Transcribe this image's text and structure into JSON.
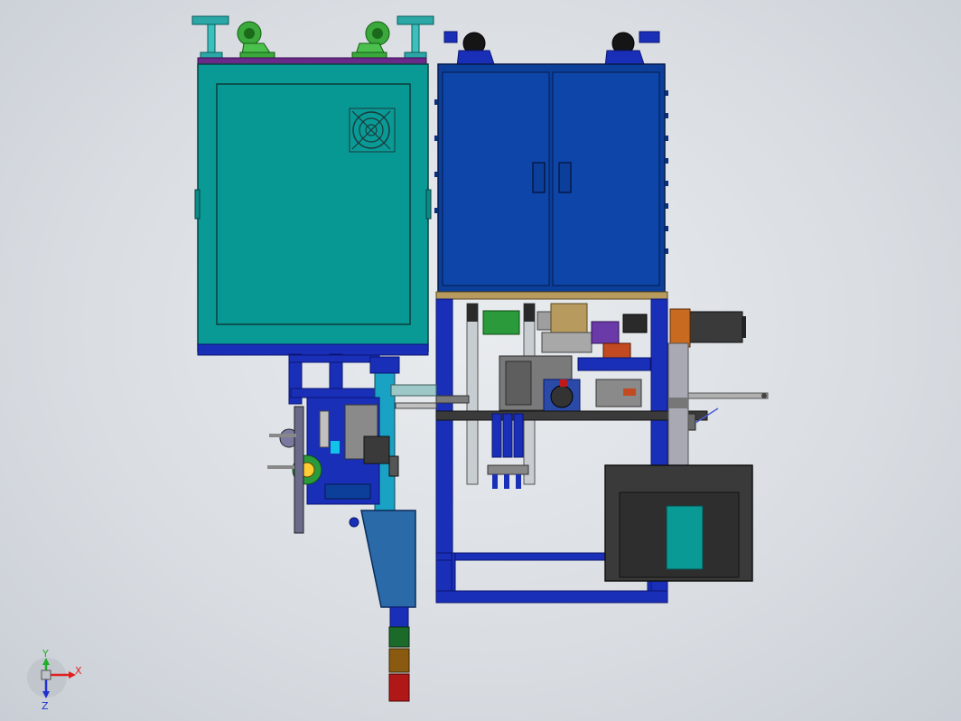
{
  "viewport": {
    "background_color": "#dde1e6"
  },
  "triad": {
    "x_label": "X",
    "y_label": "Y",
    "z_label": "Z",
    "x_color": "#e02020",
    "y_color": "#1fae2a",
    "z_color": "#2030d0"
  },
  "colors": {
    "teal_cabinet": "#0a9a96",
    "blue_cabinet": "#0c3f9a",
    "frame_blue": "#1a2fb8",
    "dark_panel": "#3a3a3a",
    "caster_green": "#3aa83a",
    "foot_teal": "#2aa7a6",
    "purple_trim": "#6a2a8a",
    "tan_plate": "#b79b5e",
    "signal_green": "#1b6a2a",
    "signal_amber": "#8a5a10",
    "signal_red": "#b01818"
  },
  "parts": [
    {
      "name": "teal-electrical-cabinet",
      "icon": "cabinet"
    },
    {
      "name": "blue-tool-cabinet",
      "icon": "double-door-cabinet"
    },
    {
      "name": "ventilation-fan",
      "icon": "fan-grille"
    },
    {
      "name": "caster-wheels",
      "icon": "caster"
    },
    {
      "name": "leveling-feet",
      "icon": "foot"
    },
    {
      "name": "machine-frame",
      "icon": "frame"
    },
    {
      "name": "servo-motor",
      "icon": "motor"
    },
    {
      "name": "signal-tower",
      "icon": "stack-light"
    },
    {
      "name": "control-panel-box",
      "icon": "panel"
    }
  ]
}
